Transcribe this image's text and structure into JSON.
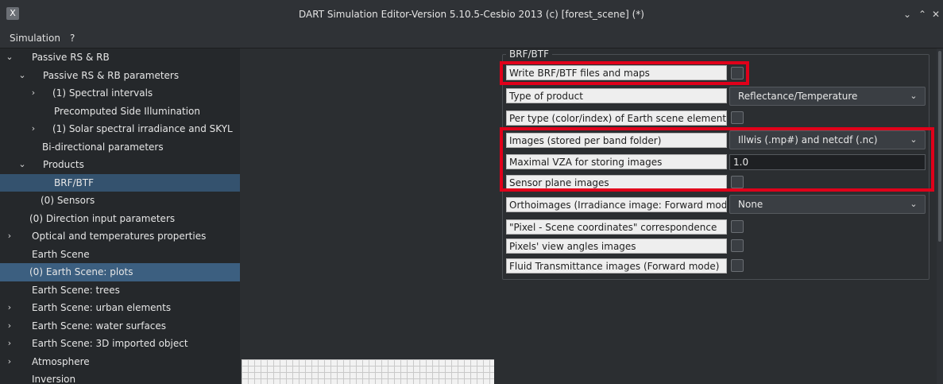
{
  "window": {
    "title": "DART Simulation Editor-Version 5.10.5-Cesbio 2013 (c) [forest_scene] (*)",
    "app_icon": "X",
    "minimize_glyph": "⌄",
    "maximize_glyph": "⌃",
    "close_glyph": "✕"
  },
  "menu": {
    "simulation": "Simulation",
    "help": "?"
  },
  "tree": {
    "items": [
      {
        "label": "Passive RS & RB",
        "arrow": "⌄"
      },
      {
        "label": "Passive RS & RB parameters",
        "arrow": "⌄"
      },
      {
        "label": "(1) Spectral intervals",
        "arrow": "›"
      },
      {
        "label": "Precomputed Side Illumination",
        "arrow": ""
      },
      {
        "label": "(1) Solar spectral irradiance and SKYL",
        "arrow": "›"
      },
      {
        "label": "Bi-directional parameters",
        "arrow": ""
      },
      {
        "label": "Products",
        "arrow": "⌄"
      },
      {
        "label": "BRF/BTF",
        "arrow": ""
      },
      {
        "label": "(0) Sensors",
        "arrow": ""
      },
      {
        "label": "(0) Direction input parameters",
        "arrow": ""
      },
      {
        "label": "Optical and temperatures properties",
        "arrow": "›"
      },
      {
        "label": "Earth Scene",
        "arrow": ""
      },
      {
        "label": "(0) Earth Scene: plots",
        "arrow": ""
      },
      {
        "label": "Earth Scene: trees",
        "arrow": ""
      },
      {
        "label": "Earth Scene: urban elements",
        "arrow": "›"
      },
      {
        "label": "Earth Scene: water surfaces",
        "arrow": "›"
      },
      {
        "label": "Earth Scene: 3D imported object",
        "arrow": "›"
      },
      {
        "label": "Atmosphere",
        "arrow": "›"
      },
      {
        "label": "Inversion",
        "arrow": ""
      }
    ]
  },
  "panel": {
    "group_title": "BRF/BTF",
    "rows": {
      "write_brf": {
        "label": "Write BRF/BTF files and maps",
        "checked": false
      },
      "type_of_product": {
        "label": "Type of product",
        "value": "Reflectance/Temperature"
      },
      "per_type": {
        "label": "Per type (color/index) of Earth scene element",
        "checked": false
      },
      "images": {
        "label": "Images    (stored per band folder)",
        "value": "Illwis (.mp#) and netcdf (.nc)"
      },
      "max_vza": {
        "label": "Maximal VZA for storing images",
        "value": "1.0"
      },
      "sensor_plane": {
        "label": "Sensor plane images",
        "checked": false
      },
      "orthoimages": {
        "label": "Orthoimages (Irradiance image: Forward mode",
        "value": "None"
      },
      "pixel_scene": {
        "label": "\"Pixel - Scene coordinates\" correspondence",
        "checked": false
      },
      "pixels_view": {
        "label": "Pixels' view angles images",
        "checked": false
      },
      "fluid": {
        "label": "Fluid Transmittance images (Forward mode)",
        "checked": false
      }
    },
    "caret_glyph": "⌄"
  },
  "colors": {
    "highlight": "#e0001a",
    "selection": "#3c5f80",
    "background": "#2b2e31"
  }
}
